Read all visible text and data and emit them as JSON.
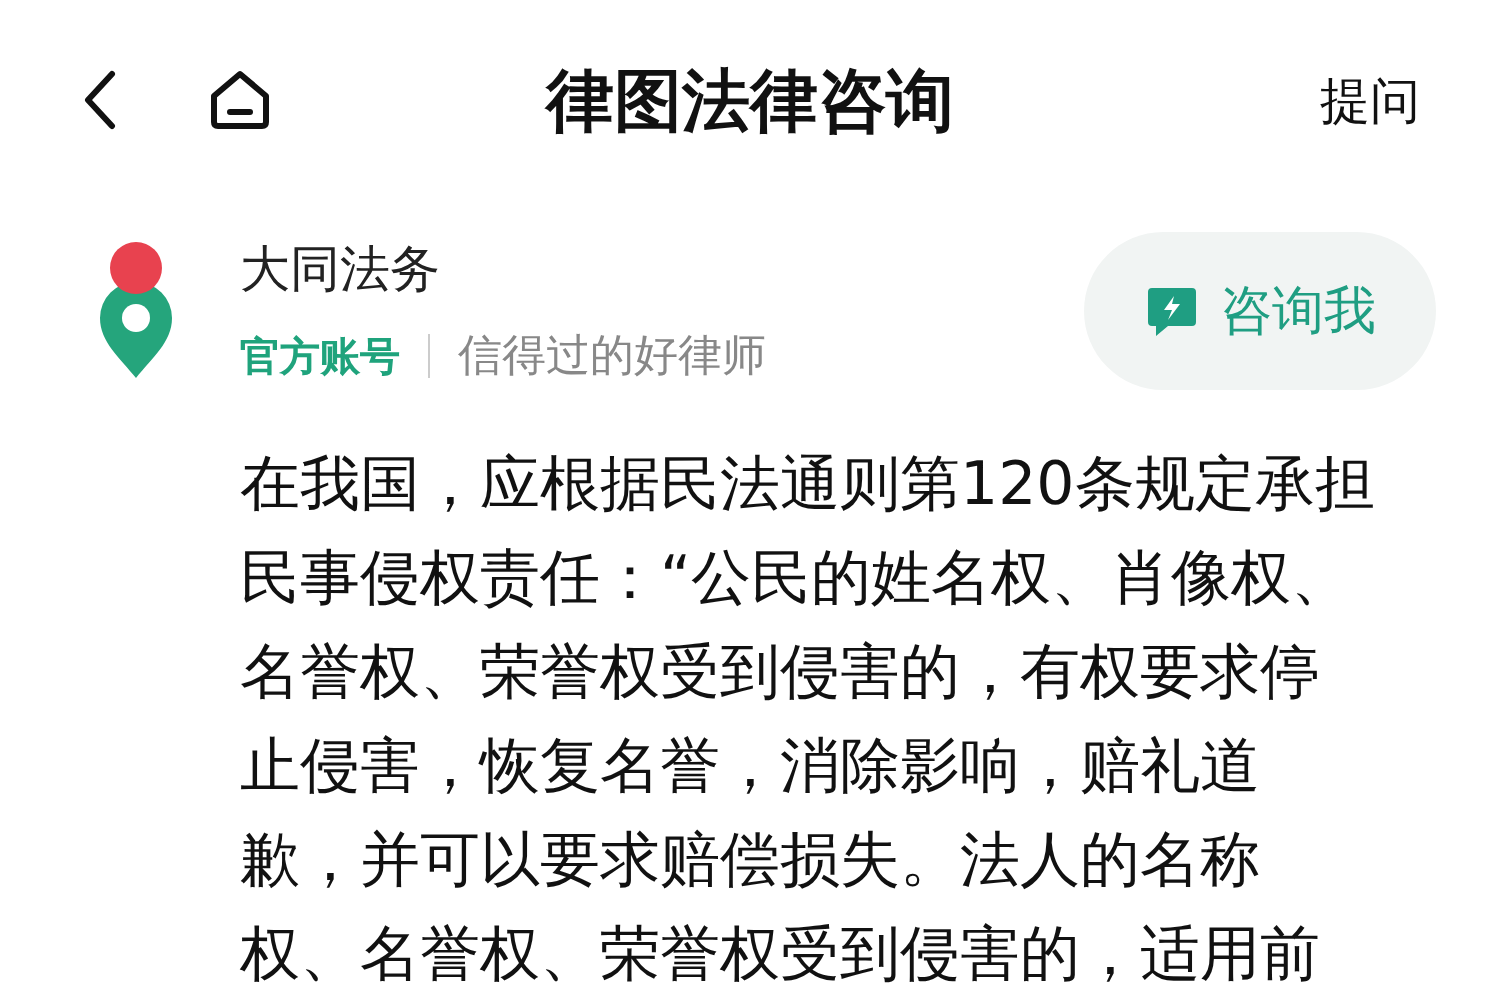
{
  "header": {
    "title": "律图法律咨询",
    "action": "提问"
  },
  "author": {
    "name": "大同法务",
    "badge": "官方账号",
    "slogan": "信得过的好律师",
    "button": "咨询我"
  },
  "body_lines": [
    "在我国，应根据民法通则第120条规定承担",
    "民事侵权责任：“公民的姓名权、肖像权、",
    "名誉权、荣誉权受到侵害的，有权要求停",
    "止侵害，恢复名誉，消除影响，赔礼道",
    "歉，并可以要求赔偿损失。法人的名称",
    "权、名誉权、荣誉权受到侵害的，适用前"
  ]
}
